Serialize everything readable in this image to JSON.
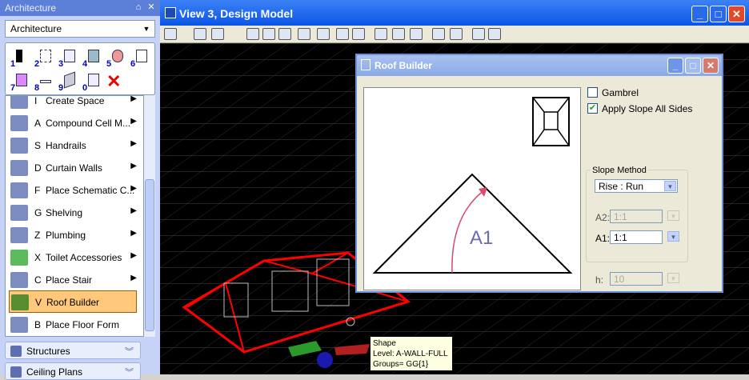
{
  "left_panel": {
    "title": "Architecture",
    "pin_glyph": "⌂",
    "close_glyph": "✕",
    "workflow_select": "Architecture",
    "tool_numbers": [
      "1",
      "2",
      "3",
      "4",
      "5",
      "6",
      "7",
      "8",
      "9",
      "0"
    ],
    "tasks": [
      {
        "key": "I",
        "label": "Create Space",
        "icon": "create-space-icon"
      },
      {
        "key": "A",
        "label": "Compound Cell M...",
        "icon": "compound-cell-icon"
      },
      {
        "key": "S",
        "label": "Handrails",
        "icon": "handrails-icon"
      },
      {
        "key": "D",
        "label": "Curtain Walls",
        "icon": "curtain-walls-icon"
      },
      {
        "key": "F",
        "label": "Place Schematic C...",
        "icon": "schematic-icon"
      },
      {
        "key": "G",
        "label": "Shelving",
        "icon": "shelving-icon"
      },
      {
        "key": "Z",
        "label": "Plumbing",
        "icon": "plumbing-icon"
      },
      {
        "key": "X",
        "label": "Toilet Accessories",
        "icon": "toilet-accessories-icon"
      },
      {
        "key": "C",
        "label": "Place Stair",
        "icon": "stair-icon"
      },
      {
        "key": "V",
        "label": "Roof Builder",
        "icon": "roof-builder-icon"
      },
      {
        "key": "B",
        "label": "Place Floor Form",
        "icon": "floor-form-icon"
      }
    ],
    "groups": [
      "Structures",
      "Ceiling Plans"
    ]
  },
  "view": {
    "title": "View 3, Design Model",
    "min_glyph": "_",
    "max_glyph": "□",
    "close_glyph": "✕"
  },
  "dialog": {
    "title": "Roof Builder",
    "gambrel_label": "Gambrel",
    "gambrel_checked": false,
    "apply_slope_label": "Apply Slope All Sides",
    "apply_slope_checked": true,
    "slope_method_label": "Slope Method",
    "slope_method_value": "Rise : Run",
    "a2_label": "A2:",
    "a2_value": "1:1",
    "a1_label": "A1:",
    "a1_value": "1:1",
    "h_label": "h:",
    "h_value": "10",
    "preview_label": "A1"
  },
  "tooltip": {
    "line1": "Shape",
    "line2": "Level: A-WALL-FULL",
    "line3": "Groups= GG{1}"
  },
  "colors": {
    "roof_outline": "#ff0000",
    "preview_arrow": "#d9486e",
    "title_blue": "#0a55e6"
  }
}
